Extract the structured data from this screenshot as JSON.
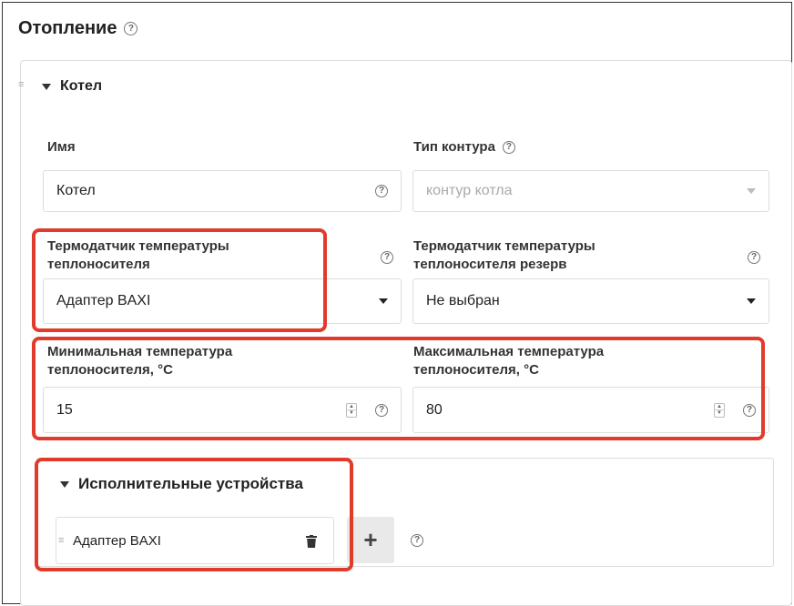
{
  "page": {
    "title": "Отопление"
  },
  "circuit": {
    "title": "Котел",
    "name_field": {
      "label": "Имя",
      "value": "Котел"
    },
    "contour_type": {
      "label": "Тип контура",
      "placeholder": "контур котла"
    },
    "sensor": {
      "label_line1": "Термодатчик температуры",
      "label_line2": "теплоносителя",
      "value": "Адаптер BAXI"
    },
    "sensor_reserve": {
      "label_line1": "Термодатчик температуры",
      "label_line2": "теплоносителя резерв",
      "value": "Не выбран"
    },
    "min_temp": {
      "label_line1": "Минимальная температура",
      "label_line2": "теплоносителя, °С",
      "value": "15"
    },
    "max_temp": {
      "label_line1": "Максимальная температура",
      "label_line2": "теплоносителя, °С",
      "value": "80"
    },
    "actuators": {
      "title": "Исполнительные устройства",
      "items": [
        {
          "label": "Адаптер BAXI"
        }
      ],
      "add_label": "+"
    }
  },
  "icons": {
    "help": "?",
    "drag": "≡"
  },
  "colors": {
    "highlight": "#e23b2c",
    "border": "#dddddd",
    "button_bg": "#e9e9e9"
  }
}
